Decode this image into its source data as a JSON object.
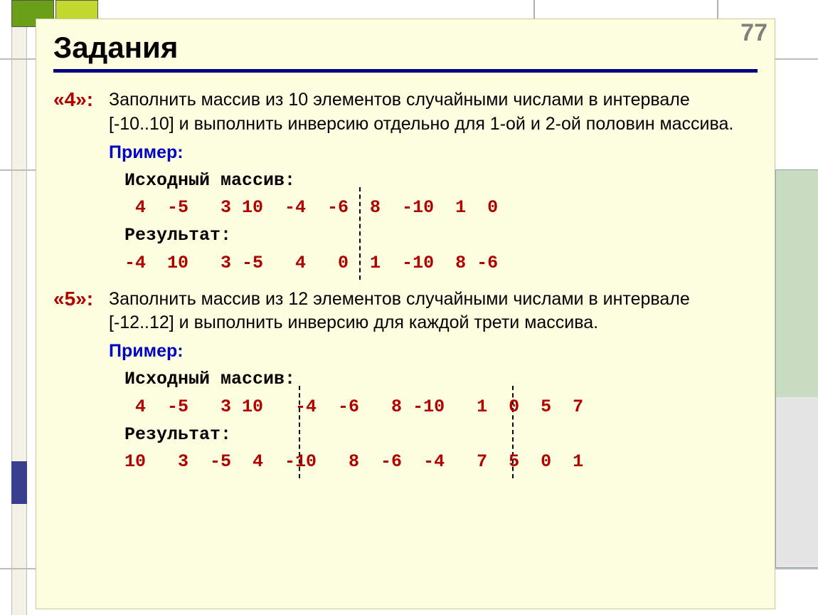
{
  "page_number": "77",
  "title": "Задания",
  "task4": {
    "label": "«4»:",
    "text": "Заполнить массив из 10 элементов случайными числами в интервале [-10..10] и выполнить инверсию отдельно для 1-ой и 2-ой половин массива.",
    "example_label": "Пример:",
    "source_label": "Исходный массив:",
    "source_values": " 4  -5   3 10  -4  -6  8  -10  1  0",
    "result_label": "Результат:",
    "result_values": "-4  10   3 -5   4   0  1  -10  8 -6"
  },
  "task5": {
    "label": "«5»:",
    "text": "Заполнить массив из 12 элементов случайными числами в интервале [-12..12] и выполнить инверсию для каждой трети массива.",
    "example_label": "Пример:",
    "source_label": "Исходный массив:",
    "source_values": " 4  -5   3 10   -4  -6   8 -10   1  0  5  7",
    "result_label": "Результат:",
    "result_values": "10   3  -5  4  -10   8  -6  -4   7  5  0  1"
  }
}
